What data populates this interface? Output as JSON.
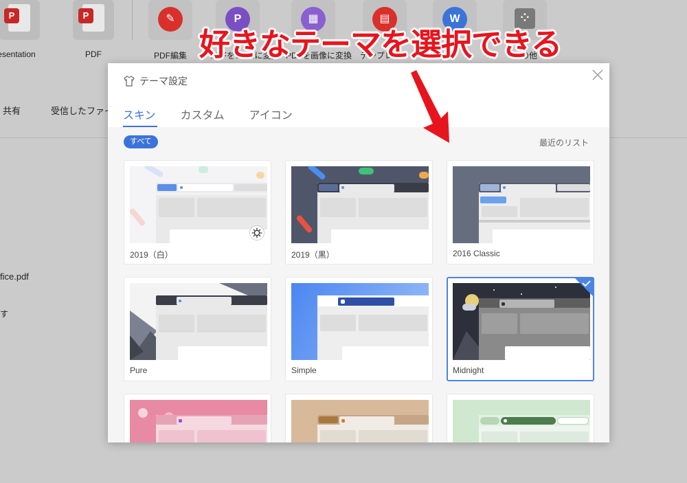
{
  "background_app": {
    "toolbar": [
      {
        "label": "Presentation"
      },
      {
        "label": "PDF"
      },
      {
        "label": "PDF編集"
      },
      {
        "label": "PDFをWordに変換"
      },
      {
        "label": "PDFを画像に変換"
      },
      {
        "label": "テンプレート"
      },
      {
        "label": ""
      },
      {
        "label": "その他"
      }
    ],
    "nav": {
      "share": "共有",
      "received": "受信したファイル"
    },
    "file_fragment": "fice.pdf",
    "text_fragment": "す"
  },
  "annotation": {
    "text": "好きなテーマを選択できる",
    "color": "#e8141d"
  },
  "dialog": {
    "title": "テーマ設定",
    "tabs": [
      {
        "label": "スキン",
        "active": true
      },
      {
        "label": "カスタム",
        "active": false
      },
      {
        "label": "アイコン",
        "active": false
      }
    ],
    "filter_chip": "すべて",
    "recent_link": "最近のリスト",
    "accent_color": "#3b73d9",
    "themes": [
      {
        "name": "2019（白）",
        "icon": "gear-icon"
      },
      {
        "name": "2019（黒）"
      },
      {
        "name": "2016 Classic"
      },
      {
        "name": "Pure"
      },
      {
        "name": "Simple"
      },
      {
        "name": "Midnight",
        "selected": true
      },
      {
        "name": ""
      },
      {
        "name": ""
      },
      {
        "name": ""
      }
    ]
  }
}
